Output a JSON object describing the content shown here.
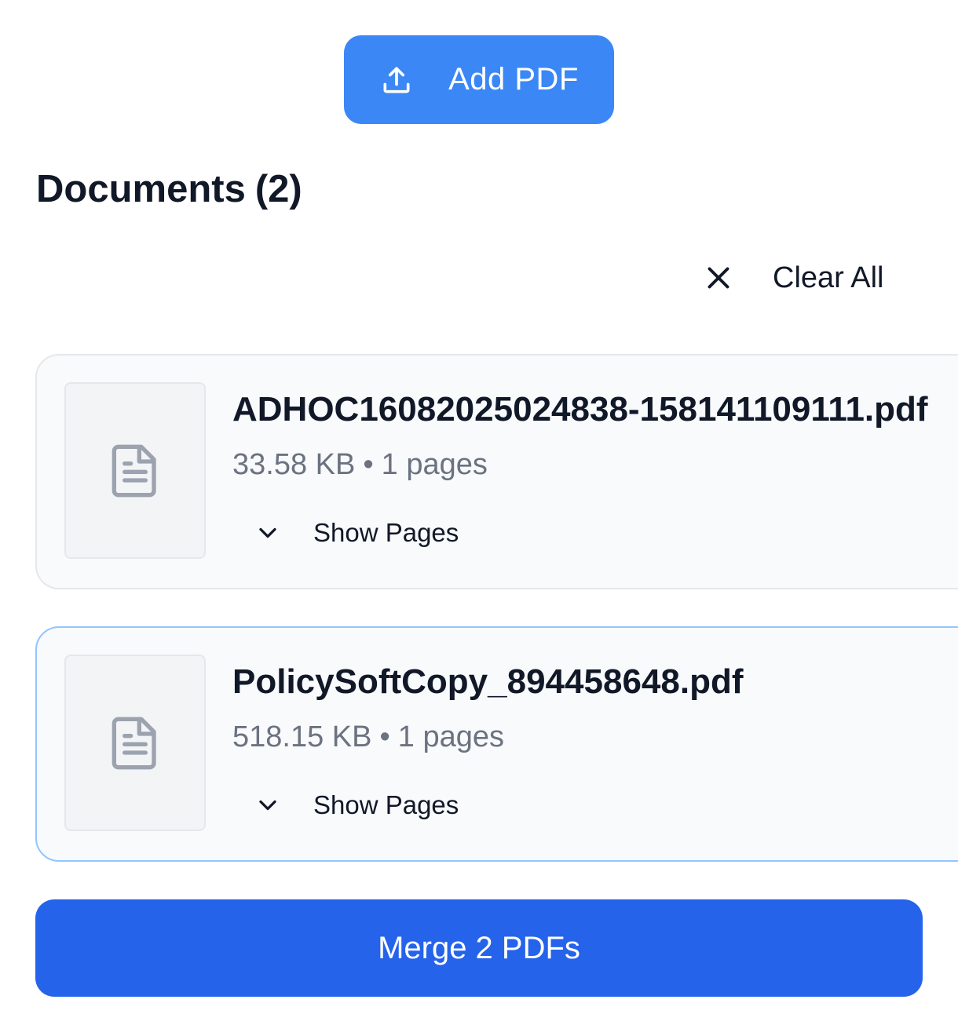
{
  "toolbar": {
    "add_pdf_label": "Add PDF",
    "add_pdf_icon": "upload-icon"
  },
  "documents_section": {
    "title": "Documents",
    "count_text": "(2)"
  },
  "clear_all": {
    "label": "Clear All",
    "icon": "close-icon"
  },
  "documents": [
    {
      "file_name": "ADHOC16082025024838-158141109111.pdf",
      "size": "33.58 KB",
      "separator": "•",
      "pages": "1 pages",
      "toggle_label": "Show Pages",
      "thumbnail_icon": "document-icon",
      "toggle_icon": "chevron-down-icon",
      "selected": false
    },
    {
      "file_name": "PolicySoftCopy_894458648.pdf",
      "size": "518.15 KB",
      "separator": "•",
      "pages": "1 pages",
      "toggle_label": "Show Pages",
      "thumbnail_icon": "document-icon",
      "toggle_icon": "chevron-down-icon",
      "selected": true
    }
  ],
  "merge": {
    "label": "Merge 2 PDFs"
  },
  "colors": {
    "add_button": "#3b87f5",
    "merge_button": "#2563eb",
    "selected_border": "#93c5fd",
    "card_background": "#f8fafc"
  }
}
